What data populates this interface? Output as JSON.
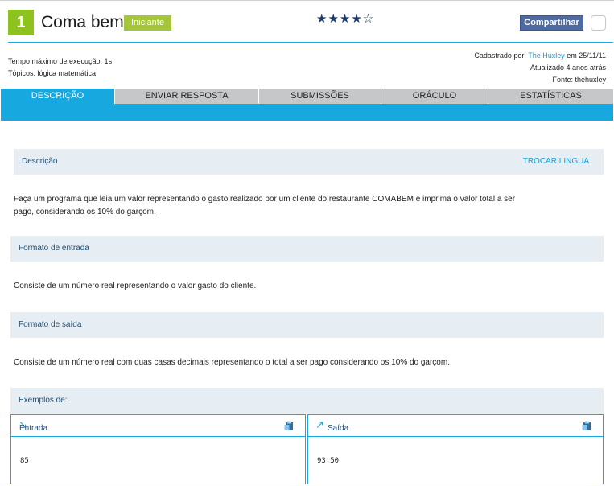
{
  "problem": {
    "number": "1",
    "title": "Coma bem",
    "level": "Iniciante",
    "rating_stars": "★★★★☆",
    "share_label": "Compartilhar"
  },
  "meta": {
    "time_limit": "Tempo máximo de execução: 1s",
    "topics": "Tópicos: lógica matemática",
    "registered_prefix": "Cadastrado por:",
    "registered_by": "The Huxley",
    "registered_date": "em 25/11/11",
    "updated": "Atualizado 4 anos atrás",
    "source": "Fonte: thehuxley"
  },
  "tabs": [
    {
      "label": "DESCRIÇÃO",
      "active": true
    },
    {
      "label": "ENVIAR RESPOSTA",
      "active": false
    },
    {
      "label": "SUBMISSÕES",
      "active": false
    },
    {
      "label": "ORÁCULO",
      "active": false
    },
    {
      "label": "ESTATÍSTICAS",
      "active": false
    }
  ],
  "description": {
    "heading": "Descrição",
    "change_language": "TROCAR LINGUA",
    "text_line1": "Faça um programa que leia um valor representando o gasto realizado por um cliente do restaurante COMABEM e imprima o valor total a ser",
    "text_line2": "pago, considerando os 10% do garçom."
  },
  "input_format": {
    "heading": "Formato de entrada",
    "text": "Consiste de um número real representando o valor gasto do cliente."
  },
  "output_format": {
    "heading": "Formato de saída",
    "text": "Consiste de um número real com duas casas decimais representando o total a ser pago considerando os 10% do garçom."
  },
  "examples": {
    "heading": "Exemplos de:",
    "input_label": "Entrada",
    "input_value": "85",
    "output_label": "Saída",
    "output_value": "93.50"
  },
  "colors": {
    "accent": "#17a8df",
    "level_green": "#a5c63a",
    "number_green": "#8dc21f",
    "share_blue": "#4e6aa0"
  }
}
